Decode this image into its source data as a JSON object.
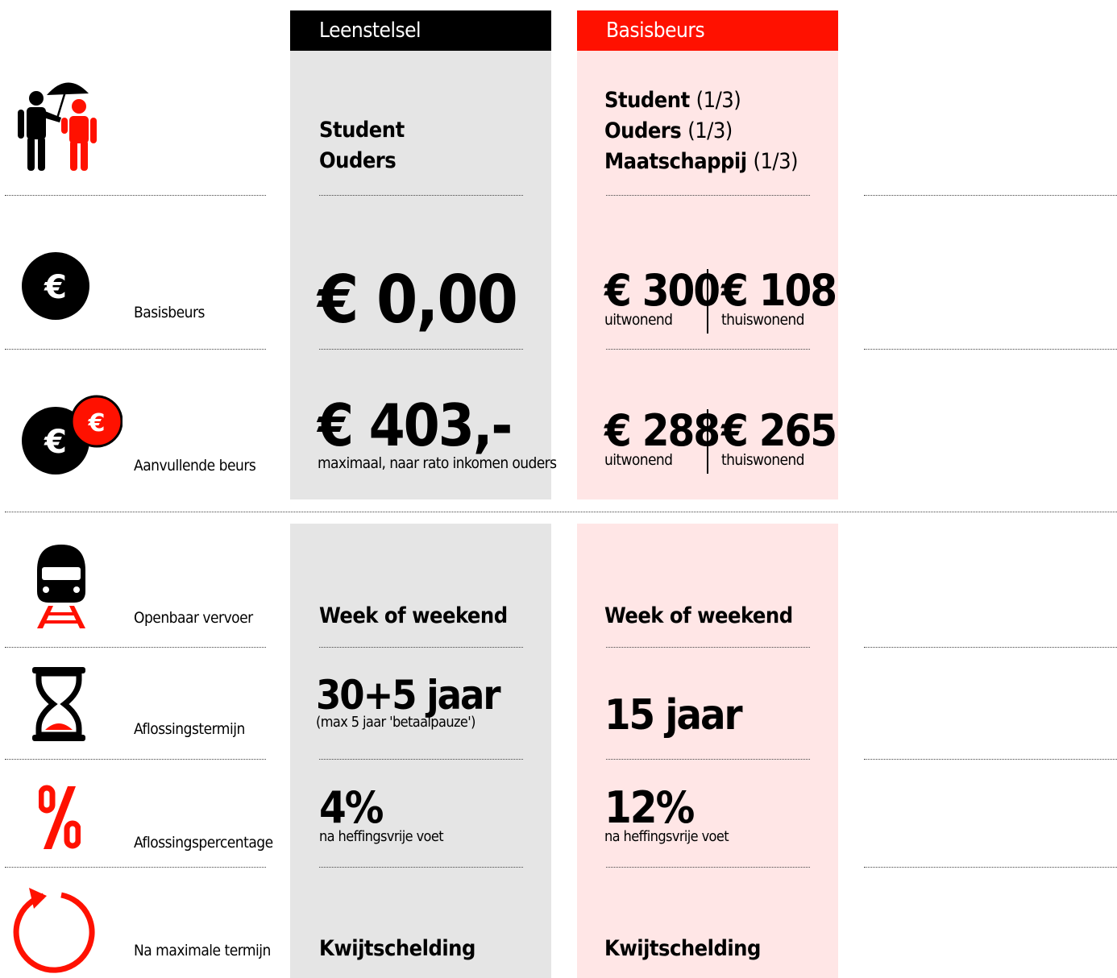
{
  "columns": {
    "left_header": "Leenstelsel",
    "right_header": "Basisbeurs"
  },
  "colors": {
    "black": "#000000",
    "red": "#ff1100",
    "gray_column": "#e5e5e5",
    "pink_column": "#ffe6e6"
  },
  "rows": {
    "payers": {
      "icon": "people-umbrella-icon",
      "left": [
        "Student",
        "Ouders"
      ],
      "right": [
        {
          "name": "Student",
          "share": "(1/3)"
        },
        {
          "name": "Ouders",
          "share": "(1/3)"
        },
        {
          "name": "Maatschappij",
          "share": "(1/3)"
        }
      ]
    },
    "basisbeurs": {
      "icon": "euro-coin-icon",
      "label": "Basisbeurs",
      "left_value": "€ 0,00",
      "right_a_value": "€ 300",
      "right_a_sub": "uitwonend",
      "right_b_value": "€ 108",
      "right_b_sub": "thuiswonend"
    },
    "aanvullend": {
      "icon": "euro-coins-icon",
      "label": "Aanvullende beurs",
      "left_value": "€ 403,-",
      "left_sub": "maximaal, naar rato inkomen ouders",
      "right_a_value": "€ 288",
      "right_a_sub": "uitwonend",
      "right_b_value": "€ 265",
      "right_b_sub": "thuiswonend"
    },
    "ov": {
      "icon": "train-icon",
      "label": "Openbaar vervoer",
      "left_value": "Week of weekend",
      "right_value": "Week of weekend"
    },
    "termijn": {
      "icon": "hourglass-icon",
      "label": "Aflossingstermijn",
      "left_value": "30+5 jaar",
      "left_sub": "(max 5 jaar 'betaalpauze')",
      "right_value": "15 jaar"
    },
    "percentage": {
      "icon": "percent-icon",
      "label": "Aflossingspercentage",
      "left_value": "4%",
      "left_sub": "na heffingsvrije voet",
      "right_value": "12%",
      "right_sub": "na heffingsvrije voet"
    },
    "na_termijn": {
      "icon": "refresh-circle-icon",
      "label": "Na maximale termijn",
      "left_value": "Kwijtschelding",
      "right_value": "Kwijtschelding"
    }
  }
}
